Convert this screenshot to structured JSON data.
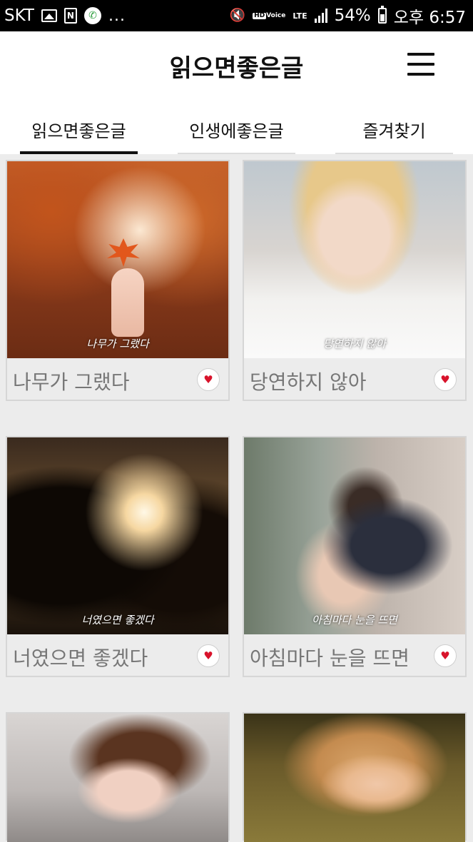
{
  "status_bar": {
    "carrier": "SKT",
    "dots": "...",
    "n_icon_label": "N",
    "hd_label": "HD",
    "voice_label": "Voice",
    "lte_label": "LTE",
    "battery": "54%",
    "time": "오후 6:57"
  },
  "header": {
    "title": "읽으면좋은글"
  },
  "tabs": [
    {
      "label": "읽으면좋은글",
      "active": true
    },
    {
      "label": "인생에좋은글",
      "active": false
    },
    {
      "label": "즐겨찾기",
      "active": false
    }
  ],
  "cards": [
    {
      "title": "나무가 그랬다",
      "caption": "나무가 그랬다"
    },
    {
      "title": "당연하지 않아",
      "caption": "당연하지 않아"
    },
    {
      "title": "너였으면 좋겠다",
      "caption": "너였으면 좋겠다"
    },
    {
      "title": "아침마다 눈을 뜨면",
      "caption": "아침마다 눈을 뜨면"
    }
  ],
  "colors": {
    "heart": "#d8132b",
    "card_bg": "#ececec",
    "title_text": "#777777"
  }
}
